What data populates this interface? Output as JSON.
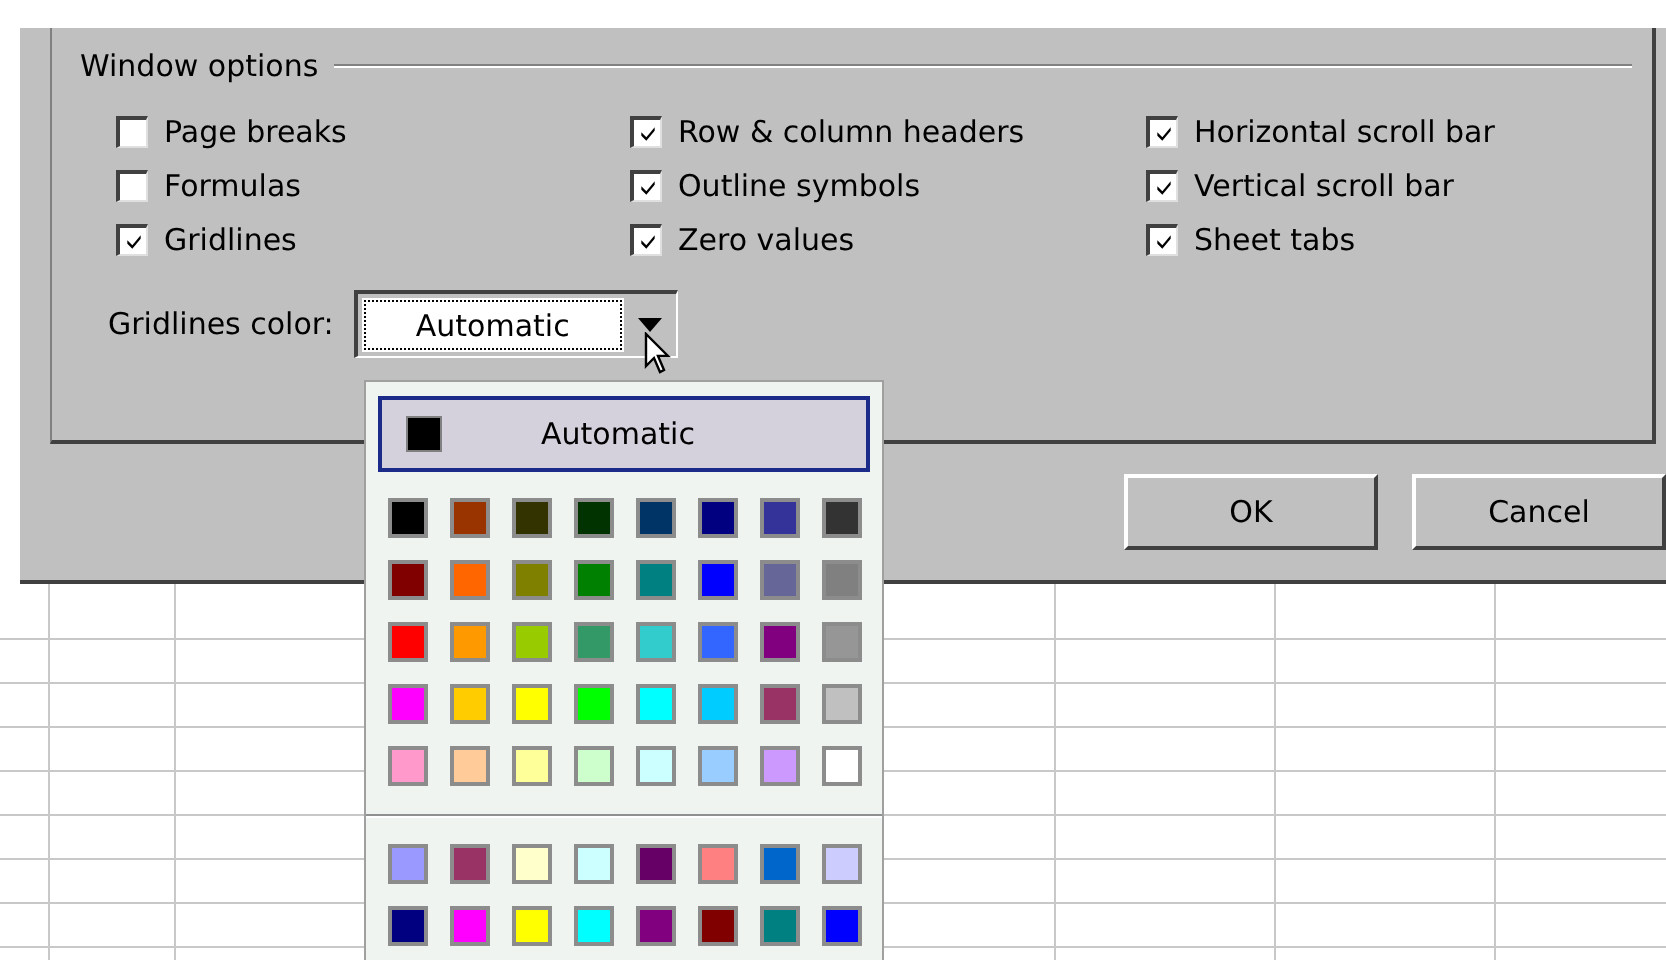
{
  "window_options": {
    "title": "Window options",
    "checkboxes": [
      {
        "label": "Page breaks",
        "checked": false
      },
      {
        "label": "Row & column headers",
        "checked": true
      },
      {
        "label": "Horizontal scroll bar",
        "checked": true
      },
      {
        "label": "Formulas",
        "checked": false
      },
      {
        "label": "Outline symbols",
        "checked": true
      },
      {
        "label": "Vertical scroll bar",
        "checked": true
      },
      {
        "label": "Gridlines",
        "checked": true
      },
      {
        "label": "Zero values",
        "checked": true
      },
      {
        "label": "Sheet tabs",
        "checked": true
      }
    ],
    "gridlines_color": {
      "label": "Gridlines color:",
      "value": "Automatic"
    }
  },
  "buttons": [
    "OK",
    "Cancel"
  ],
  "color_popup": {
    "automatic": {
      "label": "Automatic",
      "color": "#000000"
    },
    "standard_colors": [
      {
        "color": "#000000"
      },
      {
        "color": "#993300"
      },
      {
        "color": "#333300"
      },
      {
        "color": "#003300"
      },
      {
        "color": "#003366"
      },
      {
        "color": "#000080"
      },
      {
        "color": "#333399"
      },
      {
        "color": "#333333"
      },
      {
        "color": "#800000"
      },
      {
        "color": "#ff6600"
      },
      {
        "color": "#808000"
      },
      {
        "color": "#008000"
      },
      {
        "color": "#008080"
      },
      {
        "color": "#0000ff"
      },
      {
        "color": "#666699"
      },
      {
        "color": "#808080"
      },
      {
        "color": "#ff0000"
      },
      {
        "color": "#ff9900"
      },
      {
        "color": "#99cc00"
      },
      {
        "color": "#339966"
      },
      {
        "color": "#33cccc"
      },
      {
        "color": "#3366ff"
      },
      {
        "color": "#800080"
      },
      {
        "color": "#969696"
      },
      {
        "color": "#ff00ff"
      },
      {
        "color": "#ffcc00"
      },
      {
        "color": "#ffff00"
      },
      {
        "color": "#00ff00"
      },
      {
        "color": "#00ffff"
      },
      {
        "color": "#00ccff"
      },
      {
        "color": "#993366"
      },
      {
        "color": "#c0c0c0"
      },
      {
        "color": "#ff99cc"
      },
      {
        "color": "#ffcc99"
      },
      {
        "color": "#ffff99"
      },
      {
        "color": "#ccffcc"
      },
      {
        "color": "#ccffff"
      },
      {
        "color": "#99ccff"
      },
      {
        "color": "#cc99ff"
      },
      {
        "color": "#ffffff"
      }
    ],
    "chart_colors": [
      {
        "color": "#9999ff"
      },
      {
        "color": "#993366"
      },
      {
        "color": "#ffffcc"
      },
      {
        "color": "#ccffff"
      },
      {
        "color": "#660066"
      },
      {
        "color": "#ff8080"
      },
      {
        "color": "#0066cc"
      },
      {
        "color": "#ccccff"
      },
      {
        "color": "#000080"
      },
      {
        "color": "#ff00ff"
      },
      {
        "color": "#ffff00"
      },
      {
        "color": "#00ffff"
      },
      {
        "color": "#800080"
      },
      {
        "color": "#800000"
      },
      {
        "color": "#008080"
      },
      {
        "color": "#0000ff"
      }
    ]
  }
}
